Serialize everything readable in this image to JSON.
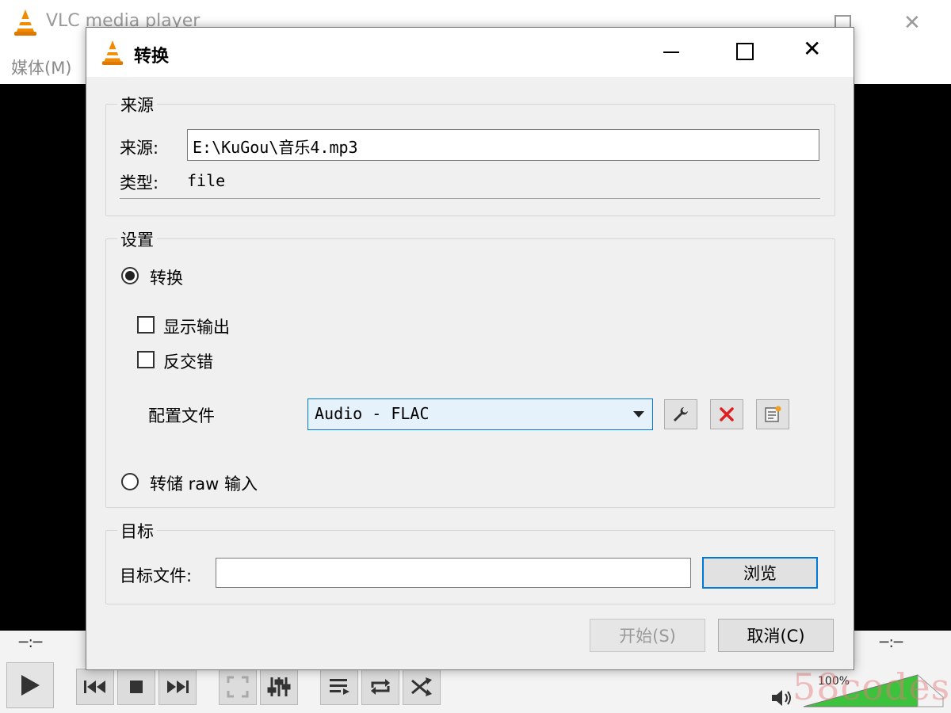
{
  "main_window": {
    "title": "VLC media player",
    "menu": [
      "媒体(M)"
    ],
    "time_elapsed": "─:─",
    "time_remaining": "─:─",
    "volume_percent": "100%",
    "volume_level": 1.0,
    "watermark": "58codes"
  },
  "dialog": {
    "title": "转换",
    "source": {
      "group_label": "来源",
      "source_label": "来源:",
      "source_value": "E:\\KuGou\\音乐4.mp3",
      "type_label": "类型:",
      "type_value": "file"
    },
    "settings": {
      "group_label": "设置",
      "convert_label": "转换",
      "convert_selected": true,
      "show_output_label": "显示输出",
      "show_output_checked": false,
      "deinterlace_label": "反交错",
      "deinterlace_checked": false,
      "profile_label": "配置文件",
      "profile_value": "Audio - FLAC",
      "dump_raw_label": "转储 raw 输入",
      "dump_raw_selected": false
    },
    "destination": {
      "group_label": "目标",
      "file_label": "目标文件:",
      "file_value": "",
      "browse_label": "浏览"
    },
    "buttons": {
      "start_label": "开始(S)",
      "cancel_label": "取消(C)"
    }
  },
  "colors": {
    "accent": "#0078d7",
    "vlc_orange": "#f08a00",
    "delete_red": "#e02020",
    "volume_green": "#3cc23c"
  }
}
